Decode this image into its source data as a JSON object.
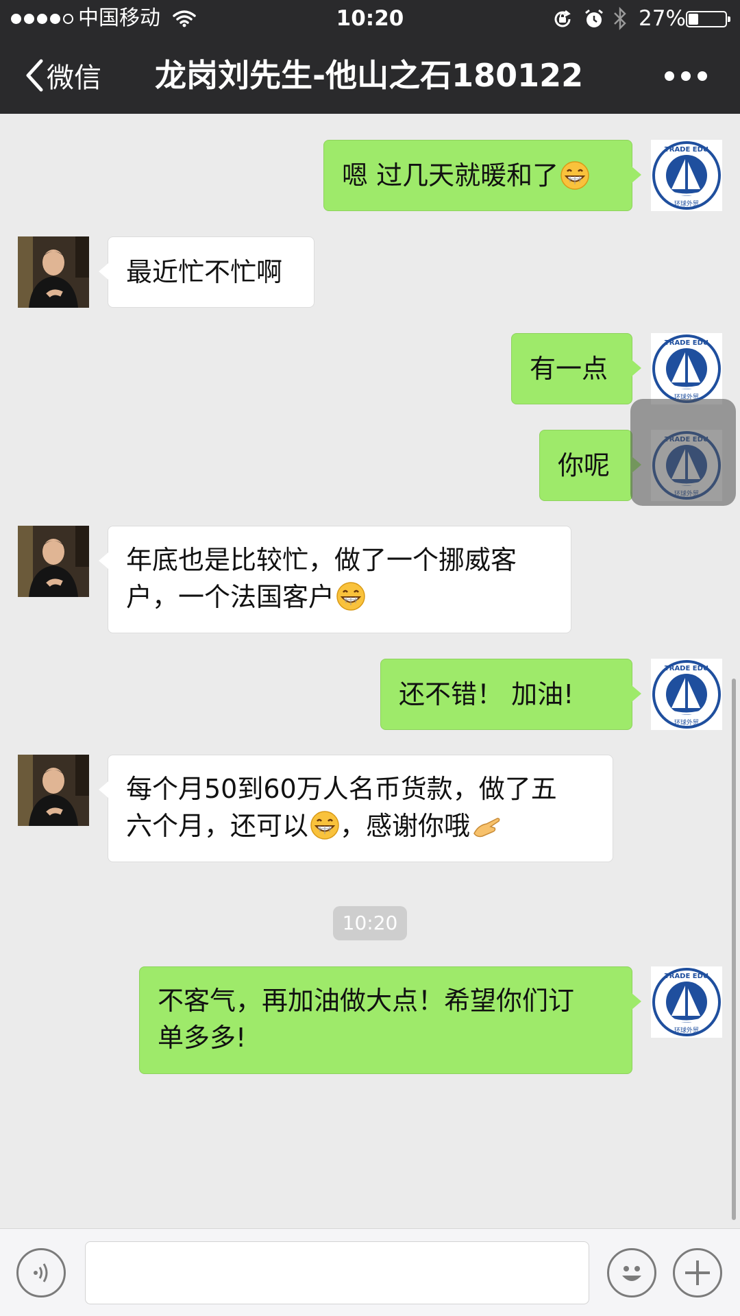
{
  "status_bar": {
    "carrier": "中国移动",
    "time": "10:20",
    "battery": "27%",
    "battery_level": 0.27
  },
  "nav": {
    "back_label": "微信",
    "title": "龙岗刘先生-他山之石180122"
  },
  "messages": [
    {
      "sender": "self",
      "text": "嗯 过几天就暖和了",
      "emoji": "grin"
    },
    {
      "sender": "other",
      "text": "最近忙不忙啊"
    },
    {
      "sender": "self",
      "text": "有一点"
    },
    {
      "sender": "self",
      "text": "你呢"
    },
    {
      "sender": "other",
      "lines": [
        "年底也是比较忙，做了一个挪威客",
        "户，一个法国客户"
      ],
      "emoji": "grin"
    },
    {
      "sender": "self",
      "text": "还不错！ 加油!"
    },
    {
      "sender": "other",
      "lines": [
        "每个月50到60万人名币货款，做了五",
        "六个月，还可以"
      ],
      "line2_tail": "，感谢你哦",
      "emoji": "grin",
      "emoji2": "pointing-hand"
    },
    {
      "sender": "self",
      "lines": [
        "不客气，再加油做大点！希望你们订",
        "单多多!"
      ]
    }
  ],
  "timestamp": "10:20",
  "avatar_self_text": "GLOBAL TRADE EDUCATION",
  "input_bar": {
    "placeholder": ""
  },
  "colors": {
    "nav_bg": "#2a2a2c",
    "chat_bg": "#ebebeb",
    "self_bubble": "#9eea6a",
    "other_bubble": "#ffffff",
    "logo_blue": "#1f4f9e"
  }
}
